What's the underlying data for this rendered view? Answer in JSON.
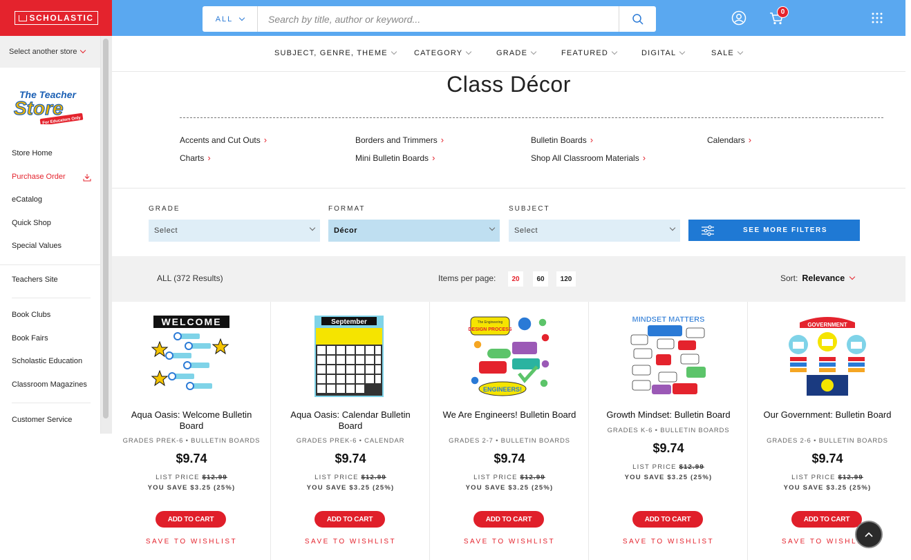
{
  "header": {
    "logo_text": "SCHOLASTIC",
    "search_category": "ALL",
    "search_placeholder": "Search by title, author or keyword...",
    "cart_count": "0"
  },
  "sidebar": {
    "store_select": "Select another store",
    "store_logo_line1": "The Teacher",
    "store_logo_line2": "Store",
    "store_logo_tag": "For Educators Only",
    "group1": [
      "Store Home",
      "Purchase Order",
      "eCatalog",
      "Quick Shop",
      "Special Values"
    ],
    "group2": [
      "Teachers Site"
    ],
    "group3": [
      "Book Clubs",
      "Book Fairs",
      "Scholastic Education",
      "Classroom Magazines"
    ],
    "group4": [
      "Customer Service"
    ]
  },
  "nav": [
    "SUBJECT, GENRE, THEME",
    "CATEGORY",
    "GRADE",
    "FEATURED",
    "DIGITAL",
    "SALE"
  ],
  "page": {
    "title": "Class Décor",
    "categories": [
      "Accents and Cut Outs",
      "Borders and Trimmers",
      "Bulletin Boards",
      "Calendars",
      "Charts",
      "Mini Bulletin Boards",
      "Shop All Classroom Materials"
    ]
  },
  "filters": {
    "grade_label": "GRADE",
    "grade_value": "Select",
    "format_label": "FORMAT",
    "format_value": "Décor",
    "subject_label": "SUBJECT",
    "subject_value": "Select",
    "more_label": "SEE MORE FILTERS"
  },
  "results": {
    "count": "ALL (372 Results)",
    "per_page_label": "Items per page:",
    "per_page_options": [
      "20",
      "60",
      "120"
    ],
    "sort_label": "Sort:",
    "sort_value": "Relevance"
  },
  "products": [
    {
      "name": "Aqua Oasis: Welcome Bulletin Board",
      "meta": "GRADES PREK-6 • BULLETIN BOARDS",
      "price": "$9.74",
      "list_label": "LIST PRICE",
      "list_price": "$12.99",
      "save": "YOU SAVE $3.25 (25%)"
    },
    {
      "name": "Aqua Oasis: Calendar Bulletin Board",
      "meta": "GRADES PREK-6 • CALENDAR",
      "price": "$9.74",
      "list_label": "LIST PRICE",
      "list_price": "$12.99",
      "save": "YOU SAVE $3.25 (25%)"
    },
    {
      "name": "We Are Engineers! Bulletin Board",
      "meta": "GRADES 2-7 • BULLETIN BOARDS",
      "price": "$9.74",
      "list_label": "LIST PRICE",
      "list_price": "$12.99",
      "save": "YOU SAVE $3.25 (25%)"
    },
    {
      "name": "Growth Mindset: Bulletin Board",
      "meta": "GRADES K-6 • BULLETIN BOARDS",
      "price": "$9.74",
      "list_label": "LIST PRICE",
      "list_price": "$12.99",
      "save": "YOU SAVE $3.25 (25%)"
    },
    {
      "name": "Our Government: Bulletin Board",
      "meta": "GRADES 2-6 • BULLETIN BOARDS",
      "price": "$9.74",
      "list_label": "LIST PRICE",
      "list_price": "$12.99",
      "save": "YOU SAVE $3.25 (25%)"
    }
  ],
  "product_actions": {
    "add_to_cart": "ADD TO CART",
    "wishlist": "SAVE TO WISHLIST"
  },
  "thumb_text": {
    "welcome": "WELCOME",
    "september": "September",
    "engineering_top": "The Engineering",
    "engineering_process": "DESIGN PROCESS",
    "engineers": "ENGINEERS!",
    "mindset": "MINDSET MATTERS",
    "government": "GOVERNMENT"
  },
  "icons": {
    "search": "search-icon",
    "account": "account-icon",
    "cart": "cart-icon",
    "apps": "apps-grid-icon",
    "download": "download-icon",
    "filters": "sliders-icon",
    "top": "back-to-top-icon"
  },
  "colors": {
    "brand_red": "#e4232d",
    "header_blue": "#5aa8f0",
    "button_blue": "#1f79d4"
  }
}
